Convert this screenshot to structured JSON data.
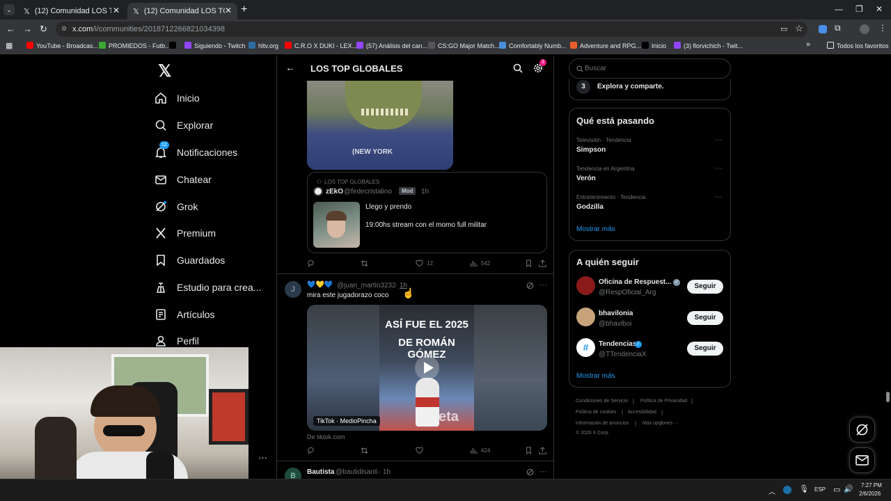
{
  "browser": {
    "tabs": [
      {
        "title": "(12) Comunidad LOS TOP GLOB"
      },
      {
        "title": "(12) Comunidad LOS TOP GLOB"
      }
    ],
    "url_host": "x.com",
    "url_path": "/i/communities/2018712266821034398",
    "bookmarks": [
      {
        "label": "YouTube - Broadcas...",
        "color": "#ff0000"
      },
      {
        "label": "PROMIEDOS - Futb...",
        "color": "#3aa832"
      },
      {
        "label": "",
        "color": "#000000"
      },
      {
        "label": "Siguiendo - Twitch",
        "color": "#9146ff"
      },
      {
        "label": "hltv.org",
        "color": "#2d6da3"
      },
      {
        "label": "C.R.O X DUKI - LEX...",
        "color": "#ff0000"
      },
      {
        "label": "(57) Análisis del can...",
        "color": "#9146ff"
      },
      {
        "label": "CS:GO Major Match...",
        "color": "#555555"
      },
      {
        "label": "Comfortably Numb...",
        "color": "#4a90d9"
      },
      {
        "label": "Adventure and RPG...",
        "color": "#e85d2a"
      },
      {
        "label": "Inicio",
        "color": "#000000"
      },
      {
        "label": "(3) florvichich - Twit...",
        "color": "#9146ff"
      }
    ],
    "all_bookmarks": "Todos los favoritos"
  },
  "sidebar": {
    "items": [
      {
        "label": "Inicio",
        "icon": "home-icon"
      },
      {
        "label": "Explorar",
        "icon": "search-icon"
      },
      {
        "label": "Notificaciones",
        "icon": "bell-icon",
        "badge": "12"
      },
      {
        "label": "Chatear",
        "icon": "mail-icon"
      },
      {
        "label": "Grok",
        "icon": "grok-icon"
      },
      {
        "label": "Premium",
        "icon": "x-icon"
      },
      {
        "label": "Guardados",
        "icon": "bookmark-icon"
      },
      {
        "label": "Estudio para crea...",
        "icon": "studio-icon"
      },
      {
        "label": "Artículos",
        "icon": "article-icon"
      },
      {
        "label": "Perfil",
        "icon": "person-icon"
      }
    ]
  },
  "feed": {
    "title": "LOS TOP GLOBALES",
    "settings_badge": "3",
    "quote": {
      "community": "LOS TOP GLOBALES",
      "name": "zEkO",
      "handle": "@fedecristalino",
      "role": "Mod",
      "time": "1h",
      "line1": "Llego y prendo",
      "line2": "19:00hs stream con el momo full militar"
    },
    "post1_stats": {
      "likes": "12",
      "views": "542"
    },
    "post2": {
      "avatar": "J",
      "emojis": "💙💛💙",
      "handle": "@juan_martin3232",
      "time": "1h",
      "text": "mira este jugadorazo coco",
      "video_title_1": "ASÍ FUE EL 2025",
      "video_title_2": "DE ROMÁN GÓMEZ",
      "video_caption": "TikTok · MedioPincha",
      "source": "De tiktok.com",
      "views": "424"
    },
    "post3": {
      "avatar": "B",
      "name": "Bautista",
      "handle": "@bautidisanti",
      "time": "1h"
    }
  },
  "right": {
    "search_placeholder": "Buscar",
    "step_number": "3",
    "step_text": "Explora y comparte.",
    "trending_title": "Qué está pasando",
    "trends": [
      {
        "meta": "Televisión · Tendencia",
        "name": "Simpson"
      },
      {
        "meta": "Tendencia en Argentina",
        "name": "Verón"
      },
      {
        "meta": "Entretenimiento · Tendencia",
        "name": "Godzilla"
      }
    ],
    "show_more": "Mostrar más",
    "follow_title": "A quién seguir",
    "follow": [
      {
        "name": "Oficina de Respuest...",
        "handle": "@RespOficial_Arg",
        "verified": true,
        "avatar_color": "#8b1a1a"
      },
      {
        "name": "bhavilonia",
        "handle": "@bhaviboi",
        "verified": false,
        "avatar_color": "#c8a27a"
      },
      {
        "name": "Tendencias",
        "handle": "@TTendenciaX",
        "verified": true,
        "avatar_color": "#1d9bf0"
      }
    ],
    "follow_btn": "Seguir",
    "show_more_2": "Mostrar más",
    "footer": [
      "Condiciones de Servicio",
      "Política de Privacidad",
      "Política de cookies",
      "Accesibilidad",
      "Información de anuncios",
      "Más opciones ···",
      "© 2026 X Corp."
    ]
  },
  "taskbar": {
    "lang": "ESP",
    "time": "7:27 PM",
    "date": "2/6/2026"
  },
  "colors": {
    "accent": "#1d9bf0",
    "muted": "#71767b",
    "border": "#2f3336"
  }
}
